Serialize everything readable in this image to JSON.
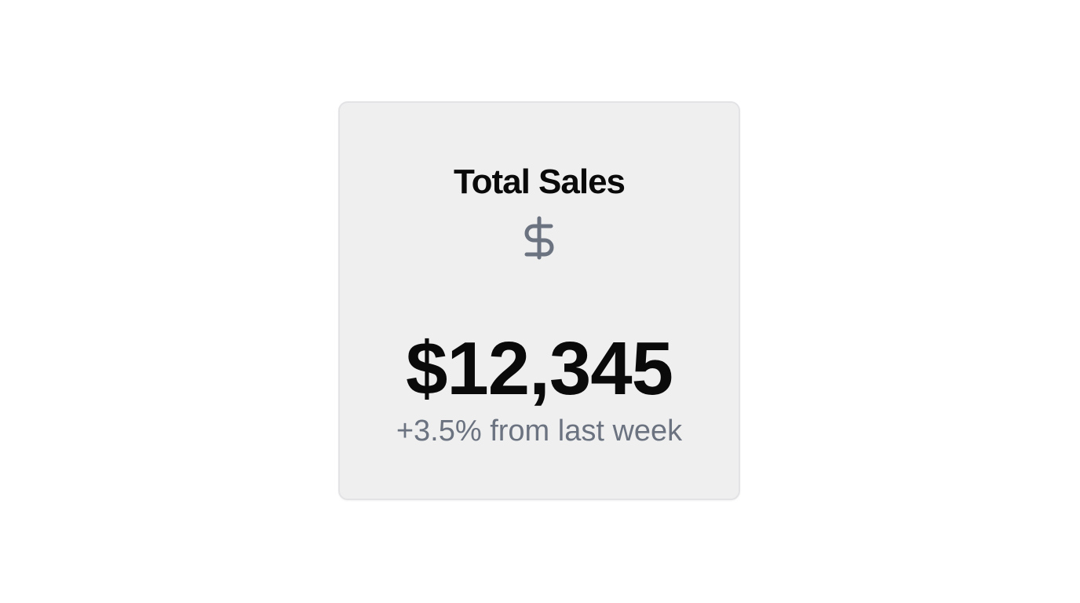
{
  "card": {
    "title": "Total Sales",
    "icon": "dollar-sign-icon",
    "value": "$12,345",
    "change": "+3.5% from last week"
  },
  "colors": {
    "card_background": "#efefef",
    "card_border": "#e3e3e6",
    "primary_text": "#0a0a0a",
    "muted_text": "#6b7280"
  }
}
